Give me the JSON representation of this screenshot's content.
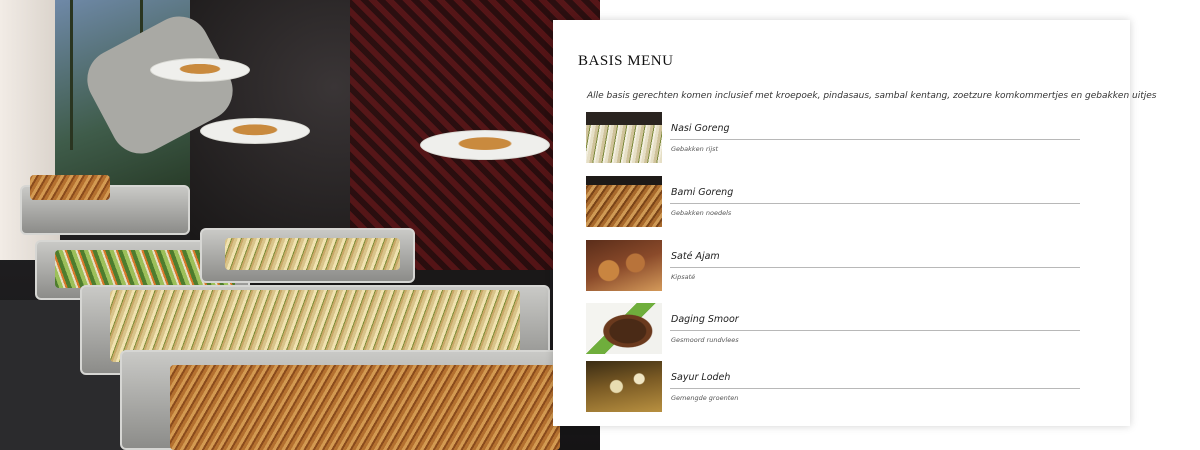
{
  "menu": {
    "title": "BASIS MENU",
    "intro": "Alle basis gerechten komen inclusief met kroepoek, pindasaus, sambal kentang, zoetzure komkommertjes en gebakken uitjes",
    "dishes": [
      {
        "name": "Nasi Goreng",
        "description": "Gebakken rijst"
      },
      {
        "name": "Bami Goreng",
        "description": "Gebakken noedels"
      },
      {
        "name": "Saté Ajam",
        "description": "Kipsaté"
      },
      {
        "name": "Daging Smoor",
        "description": "Gesmoord rundvlees"
      },
      {
        "name": "Sayur Lodeh",
        "description": "Gemengde groenten"
      }
    ]
  }
}
